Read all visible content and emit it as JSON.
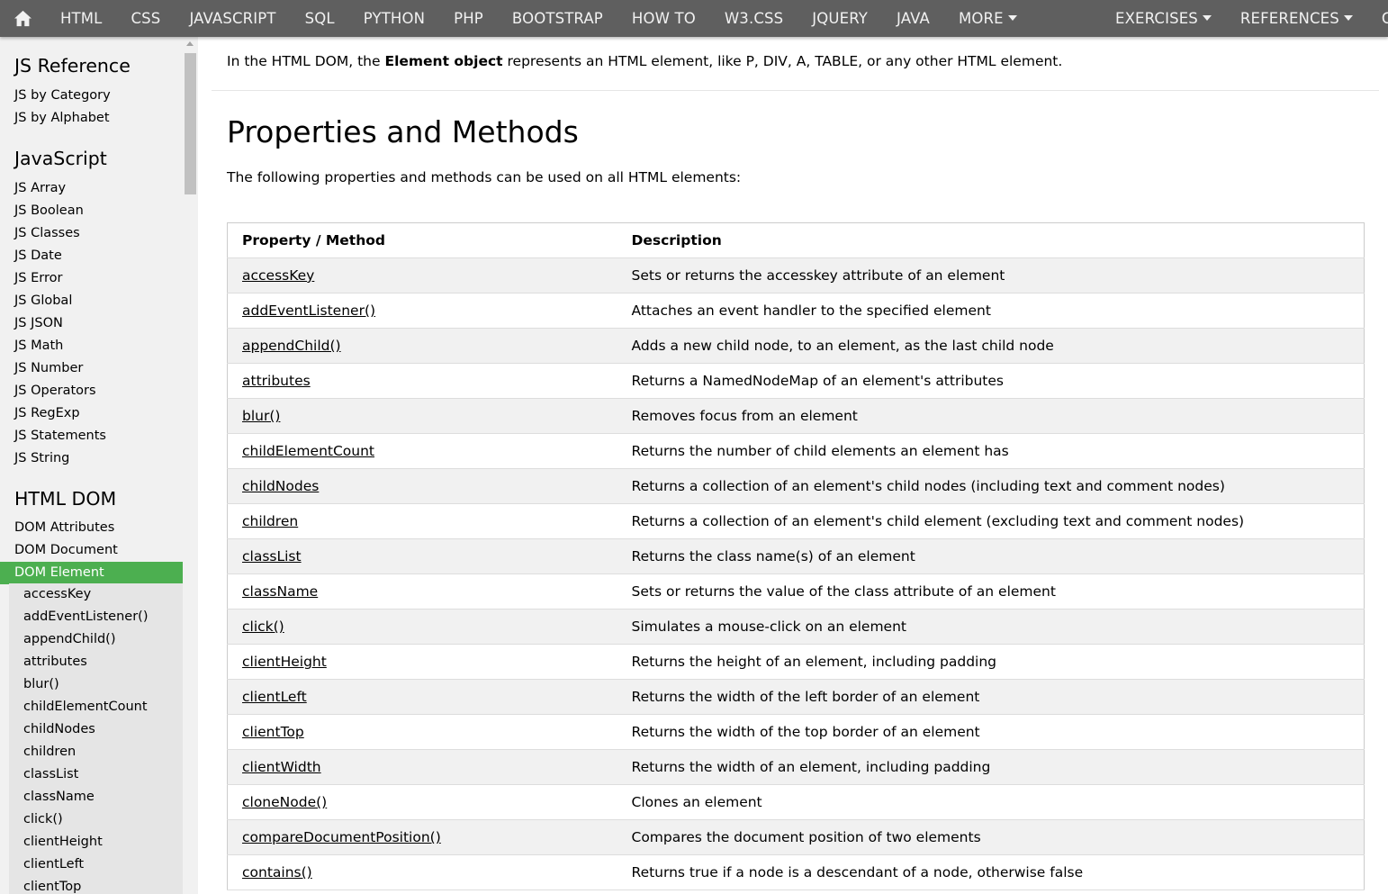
{
  "nav": {
    "home_icon": "home-icon",
    "left_items": [
      "HTML",
      "CSS",
      "JAVASCRIPT",
      "SQL",
      "PYTHON",
      "PHP",
      "BOOTSTRAP",
      "HOW TO",
      "W3.CSS",
      "JQUERY",
      "JAVA"
    ],
    "more": "MORE",
    "right_items": [
      "EXERCISES",
      "REFERENCES",
      "CE"
    ]
  },
  "sidebar": {
    "groups": [
      {
        "heading": "JS Reference",
        "links": [
          "JS by Category",
          "JS by Alphabet"
        ]
      },
      {
        "heading": "JavaScript",
        "links": [
          "JS Array",
          "JS Boolean",
          "JS Classes",
          "JS Date",
          "JS Error",
          "JS Global",
          "JS JSON",
          "JS Math",
          "JS Number",
          "JS Operators",
          "JS RegExp",
          "JS Statements",
          "JS String"
        ]
      },
      {
        "heading": "HTML DOM",
        "links": [
          "DOM Attributes",
          "DOM Document",
          "DOM Element"
        ]
      }
    ],
    "active_link": "DOM Element",
    "sub_links": [
      "accessKey",
      "addEventListener()",
      "appendChild()",
      "attributes",
      "blur()",
      "childElementCount",
      "childNodes",
      "children",
      "classList",
      "className",
      "click()",
      "clientHeight",
      "clientLeft",
      "clientTop"
    ]
  },
  "main": {
    "intro_before": "In the HTML DOM, the ",
    "intro_bold": "Element object",
    "intro_after": " represents an HTML element, like P, DIV, A, TABLE, or any other HTML element.",
    "section_title": "Properties and Methods",
    "section_desc": "The following properties and methods can be used on all HTML elements:",
    "table": {
      "headers": [
        "Property / Method",
        "Description"
      ],
      "rows": [
        {
          "name": "accessKey",
          "desc": "Sets or returns the accesskey attribute of an element"
        },
        {
          "name": "addEventListener()",
          "desc": "Attaches an event handler to the specified element"
        },
        {
          "name": "appendChild()",
          "desc": "Adds a new child node, to an element, as the last child node"
        },
        {
          "name": "attributes",
          "desc": "Returns a NamedNodeMap of an element's attributes"
        },
        {
          "name": "blur()",
          "desc": "Removes focus from an element"
        },
        {
          "name": "childElementCount",
          "desc": "Returns the number of child elements an element has"
        },
        {
          "name": "childNodes",
          "desc": "Returns a collection of an element's child nodes (including text and comment nodes)"
        },
        {
          "name": "children",
          "desc": "Returns a collection of an element's child element (excluding text and comment nodes)"
        },
        {
          "name": "classList",
          "desc": "Returns the class name(s) of an element"
        },
        {
          "name": "className",
          "desc": "Sets or returns the value of the class attribute of an element"
        },
        {
          "name": "click()",
          "desc": "Simulates a mouse-click on an element"
        },
        {
          "name": "clientHeight",
          "desc": "Returns the height of an element, including padding"
        },
        {
          "name": "clientLeft",
          "desc": "Returns the width of the left border of an element"
        },
        {
          "name": "clientTop",
          "desc": "Returns the width of the top border of an element"
        },
        {
          "name": "clientWidth",
          "desc": "Returns the width of an element, including padding"
        },
        {
          "name": "cloneNode()",
          "desc": "Clones an element"
        },
        {
          "name": "compareDocumentPosition()",
          "desc": "Compares the document position of two elements"
        },
        {
          "name": "contains()",
          "desc": "Returns true if a node is a descendant of a node, otherwise false"
        }
      ]
    }
  },
  "colors": {
    "nav_bg": "#5f5f5f",
    "sidebar_bg": "#f1f1f1",
    "active_green": "#4caf50",
    "sublist_bg": "#e5e5e5"
  }
}
